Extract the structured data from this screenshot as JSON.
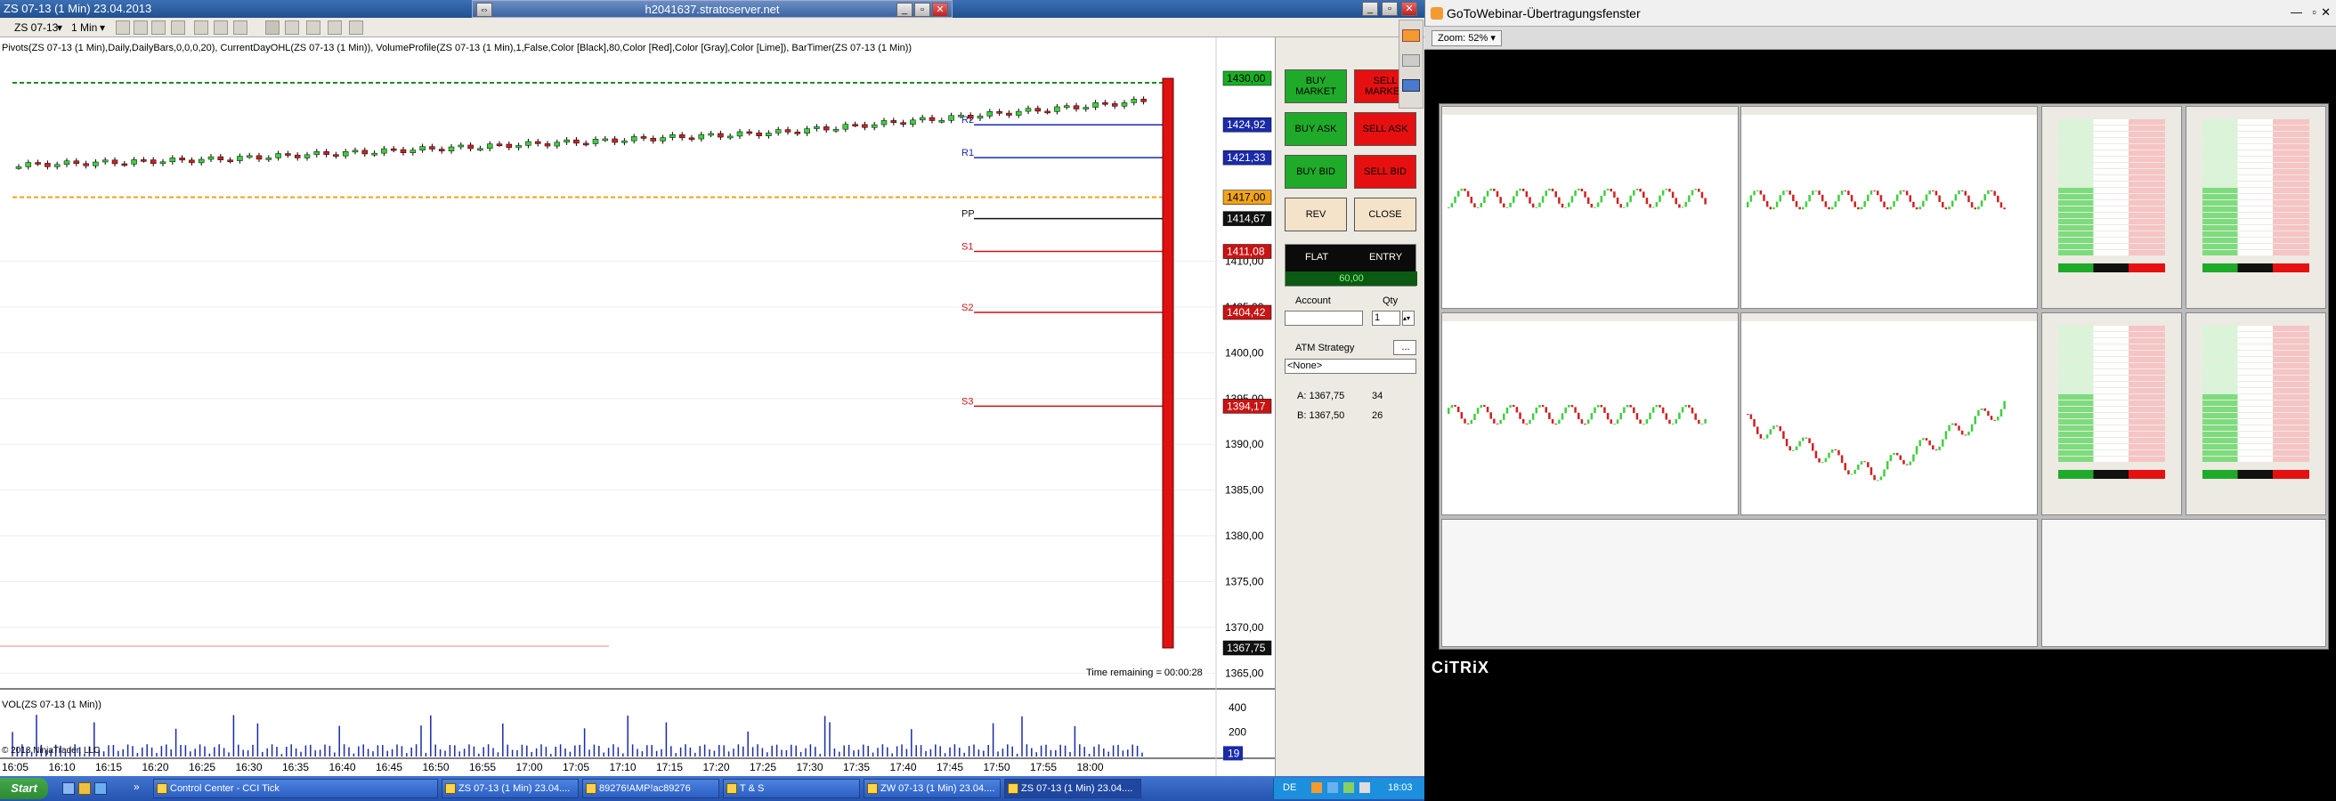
{
  "window": {
    "title": "ZS 07-13 (1 Min)  23.04.2013",
    "remote_host": "h2041637.stratoserver.net"
  },
  "toolbar": {
    "instrument": "ZS 07-13",
    "interval": "1 Min"
  },
  "chart": {
    "indicators": "Pivots(ZS 07-13 (1 Min),Daily,DailyBars,0,0,0,20), CurrentDayOHL(ZS 07-13 (1 Min)), VolumeProfile(ZS 07-13 (1 Min),1,False,Color [Black],80,Color [Red],Color [Gray],Color [Lime]), BarTimer(ZS 07-13 (1 Min))",
    "time_remaining": "Time remaining = 00:00:28",
    "volume_label": "VOL(ZS 07-13 (1 Min))",
    "copyright": "© 2013 NinjaTrader, LLC",
    "pivot_labels": [
      "R2",
      "R1",
      "PP",
      "S1",
      "S2",
      "S3"
    ],
    "price_ticks": [
      "1410,00",
      "1405,00",
      "1400,00",
      "1395,00",
      "1390,00",
      "1385,00",
      "1380,00",
      "1375,00",
      "1370,00",
      "1365,00"
    ],
    "volume_ticks": [
      "400",
      "200"
    ],
    "time_ticks": [
      "16:05",
      "16:10",
      "16:15",
      "16:20",
      "16:25",
      "16:30",
      "16:35",
      "16:40",
      "16:45",
      "16:50",
      "16:55",
      "17:00",
      "17:05",
      "17:10",
      "17:15",
      "17:20",
      "17:25",
      "17:30",
      "17:35",
      "17:40",
      "17:45",
      "17:50",
      "17:55",
      "18:00"
    ],
    "price_markers": [
      {
        "label": "1430,00",
        "price": 1430.0,
        "bg": "#18b022",
        "fg": "#000000"
      },
      {
        "label": "1424,92",
        "price": 1424.92,
        "bg": "#1a2aa8",
        "fg": "#ffffff"
      },
      {
        "label": "1421,33",
        "price": 1421.33,
        "bg": "#1a2aa8",
        "fg": "#ffffff"
      },
      {
        "label": "1417,00",
        "price": 1417.0,
        "bg": "#f2a31a",
        "fg": "#000000"
      },
      {
        "label": "1414,67",
        "price": 1414.67,
        "bg": "#111111",
        "fg": "#ffffff"
      },
      {
        "label": "1411,08",
        "price": 1411.08,
        "bg": "#c81414",
        "fg": "#ffffff"
      },
      {
        "label": "1404,42",
        "price": 1404.42,
        "bg": "#c81414",
        "fg": "#ffffff"
      },
      {
        "label": "1394,17",
        "price": 1394.17,
        "bg": "#c81414",
        "fg": "#ffffff"
      },
      {
        "label": "1367,75",
        "price": 1367.75,
        "bg": "#111111",
        "fg": "#ffffff"
      }
    ],
    "volume_marker": "19"
  },
  "order_panel": {
    "buy_market": "BUY MARKET",
    "sell_market": "SELL MARKET",
    "buy_ask": "BUY ASK",
    "sell_ask": "SELL ASK",
    "buy_bid": "BUY BID",
    "sell_bid": "SELL BID",
    "rev": "REV",
    "close": "CLOSE",
    "flat": "FLAT",
    "entry": "ENTRY",
    "pnl": "60,00",
    "account_label": "Account",
    "qty_label": "Qty",
    "qty_value": "1",
    "atm_label": "ATM Strategy",
    "atm_value": "<None>",
    "ask_line": "A: 1367,75",
    "ask_qty": "34",
    "bid_line": "B: 1367,50",
    "bid_qty": "26"
  },
  "taskbar": {
    "start": "Start",
    "tasks": [
      "Control Center - CCI Tick",
      "ZS 07-13 (1 Min)  23.04....",
      "89276!AMP!ac89276",
      "T & S",
      "ZW 07-13 (1 Min)  23.04....",
      "ZS 07-13 (1 Min)  23.04...."
    ],
    "lang": "DE",
    "clock": "18:03"
  },
  "gotowebinar": {
    "title": "GoToWebinar-Übertragungsfenster",
    "zoom": "Zoom: 52%",
    "citrix": "CiTRiX"
  }
}
